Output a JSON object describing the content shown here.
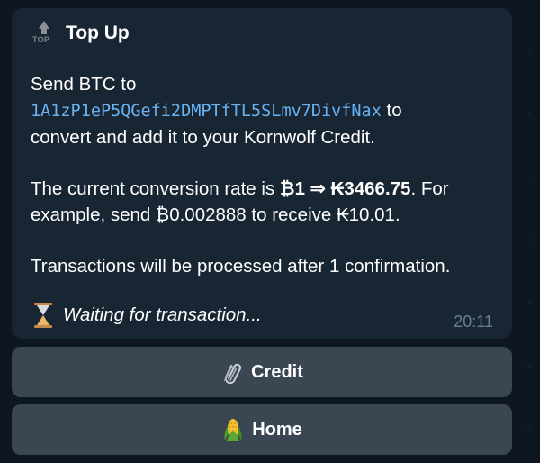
{
  "message": {
    "title": "Top Up",
    "title_icon": "top-arrow-icon",
    "title_icon_label": "TOP",
    "line1_prefix": "Send BTC to",
    "address": "1A1zP1eP5QGefi2DMPTfTL5SLmv7DivfNax",
    "line1_suffix": " to",
    "line2": "convert and add it to your Kornwolf Credit.",
    "rate_prefix": "The current conversion rate is ",
    "rate_value": "₿1 ⇒ ₭3466.75",
    "rate_suffix": ". For",
    "example_line": "example, send ₿0.002888 to receive ₭10.01.",
    "processing_line": "Transactions will be processed after 1 confirmation.",
    "status_icon": "hourglass-icon",
    "status_text": "Waiting for transaction...",
    "time": "20:11"
  },
  "keyboard": {
    "credit_label": "Credit",
    "credit_icon": "paperclip-icon",
    "home_label": "Home",
    "home_icon": "corn-icon"
  },
  "colors": {
    "background": "#0e1621",
    "bubble": "#182533",
    "link": "#6ab3f3",
    "time": "#6d7f8f",
    "button": "#3a4652"
  }
}
